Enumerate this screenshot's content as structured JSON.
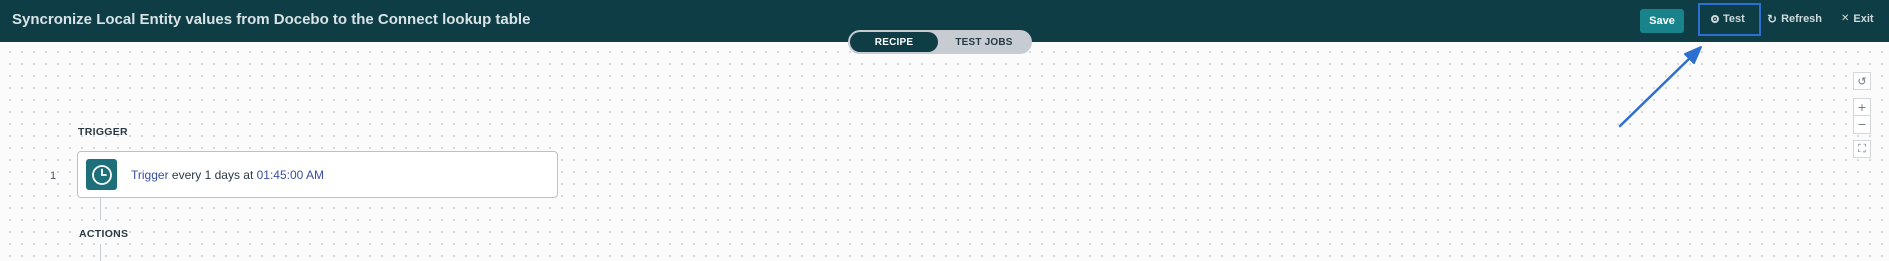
{
  "header": {
    "recipe_title": "Syncronize Local Entity values from Docebo to the Connect lookup table",
    "save_label": "Save",
    "test_label": "Test",
    "refresh_label": "Refresh",
    "exit_label": "Exit",
    "refresh_icon": "↻",
    "exit_icon": "✕"
  },
  "tabs": {
    "recipe": "RECIPE",
    "test_jobs": "TEST JOBS",
    "active": "RECIPE"
  },
  "canvas_controls": {
    "reset_icon": "↺",
    "zoom_in_icon": "+",
    "zoom_out_icon": "−",
    "fit_icon": "⛶"
  },
  "recipe": {
    "trigger_heading": "TRIGGER",
    "actions_heading": "ACTIONS",
    "trigger_step": {
      "number": "1",
      "keyword": "Trigger",
      "text_middle": " every 1 days at ",
      "time": "01:45:00 AM",
      "icon": "clock-icon"
    }
  },
  "colors": {
    "header_bg": "#0e3d45",
    "save_btn": "#19838c",
    "highlight_box": "#2d6fd0",
    "annotation_arrow": "#2d6fd0",
    "link_text": "#3a4fa0",
    "trigger_icon_bg": "#1d6f7a"
  }
}
